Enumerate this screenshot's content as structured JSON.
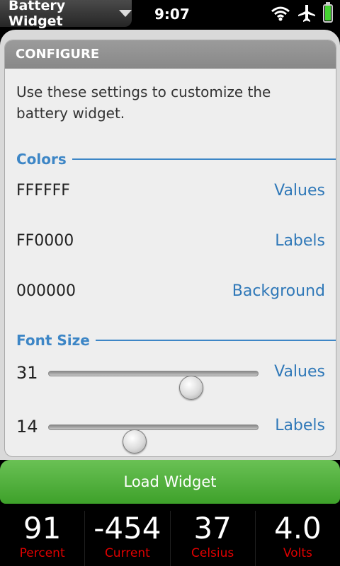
{
  "status_bar": {
    "app_title": "Battery Widget",
    "time": "9:07",
    "icons": [
      "wifi-icon",
      "airplane-icon",
      "battery-icon"
    ],
    "battery_fill_fraction": 0.95
  },
  "configure": {
    "header": "CONFIGURE",
    "description": "Use these settings to customize the battery widget.",
    "colors": {
      "title": "Colors",
      "items": [
        {
          "value": "FFFFFF",
          "label": "Values"
        },
        {
          "value": "FF0000",
          "label": "Labels"
        },
        {
          "value": "000000",
          "label": "Background"
        }
      ]
    },
    "font_size": {
      "title": "Font Size",
      "items": [
        {
          "value": "31",
          "label": "Values",
          "slider_fraction": 0.68
        },
        {
          "value": "14",
          "label": "Labels",
          "slider_fraction": 0.41
        }
      ]
    }
  },
  "load_button": "Load Widget",
  "stats": [
    {
      "value": "91",
      "label": "Percent"
    },
    {
      "value": "-454",
      "label": "Current"
    },
    {
      "value": "37",
      "label": "Celsius"
    },
    {
      "value": "4.0",
      "label": "Volts"
    }
  ],
  "colors": {
    "accent": "#3d86c6",
    "button_green": "#4cad35",
    "stat_label": "#e00000"
  }
}
